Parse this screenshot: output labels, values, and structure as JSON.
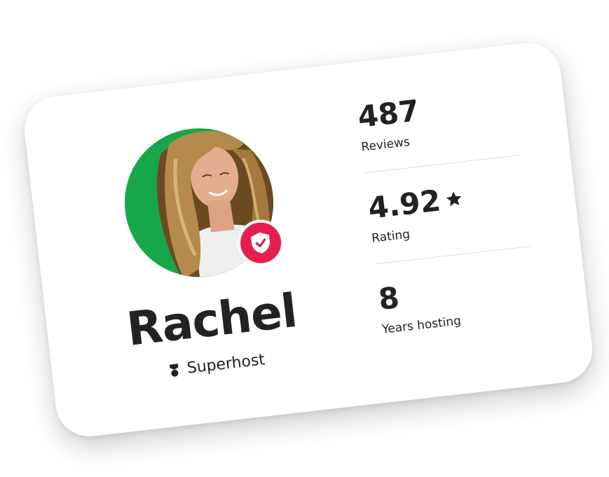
{
  "host": {
    "name": "Rachel",
    "status": "Superhost",
    "avatar_icon": "host-profile-photo",
    "verified_icon": "shield-check-icon"
  },
  "stats": {
    "reviews": {
      "value": "487",
      "label": "Reviews"
    },
    "rating": {
      "value": "4.92",
      "label": "Rating",
      "icon": "star-icon"
    },
    "years": {
      "value": "8",
      "label": "Years hosting"
    }
  },
  "colors": {
    "badge": "#e61e4d",
    "text": "#222222",
    "avatar_bg": "#17a64a"
  }
}
